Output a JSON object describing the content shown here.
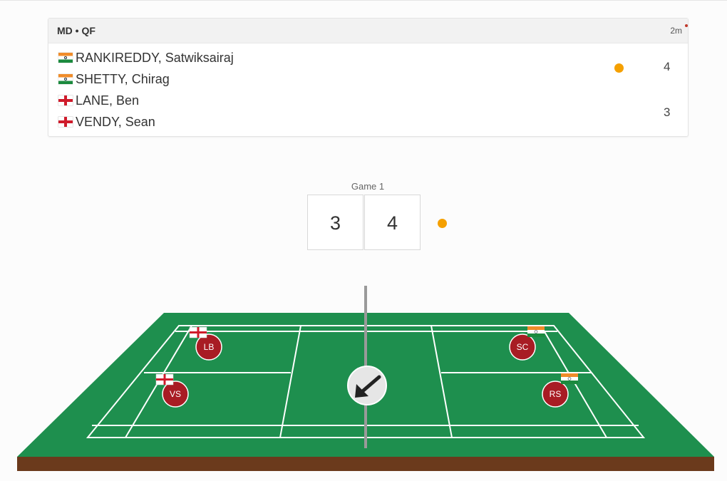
{
  "match": {
    "event": "MD • QF",
    "elapsed": "2m",
    "team1": {
      "players": [
        {
          "name": "RANKIREDDY, Satwiksairaj",
          "flag": "india-flag-icon"
        },
        {
          "name": "SHETTY, Chirag",
          "flag": "india-flag-icon"
        }
      ],
      "score": "4",
      "serving": true
    },
    "team2": {
      "players": [
        {
          "name": "LANE, Ben",
          "flag": "england-flag-icon"
        },
        {
          "name": "VENDY, Sean",
          "flag": "england-flag-icon"
        }
      ],
      "score": "3",
      "serving": false
    }
  },
  "game": {
    "label": "Game 1",
    "left_score": "3",
    "right_score": "4",
    "serve_indicator": "right"
  },
  "court": {
    "players": [
      {
        "initials": "LB",
        "flag": "england-flag-icon"
      },
      {
        "initials": "VS",
        "flag": "england-flag-icon"
      },
      {
        "initials": "SC",
        "flag": "india-flag-icon"
      },
      {
        "initials": "RS",
        "flag": "india-flag-icon"
      }
    ],
    "shuttle_direction": "down-left-arrow-icon"
  },
  "colors": {
    "court_green": "#1e8f4e",
    "player_marker": "#a81c24",
    "serve_dot": "#f5a000",
    "court_base": "#6b3a1c"
  }
}
